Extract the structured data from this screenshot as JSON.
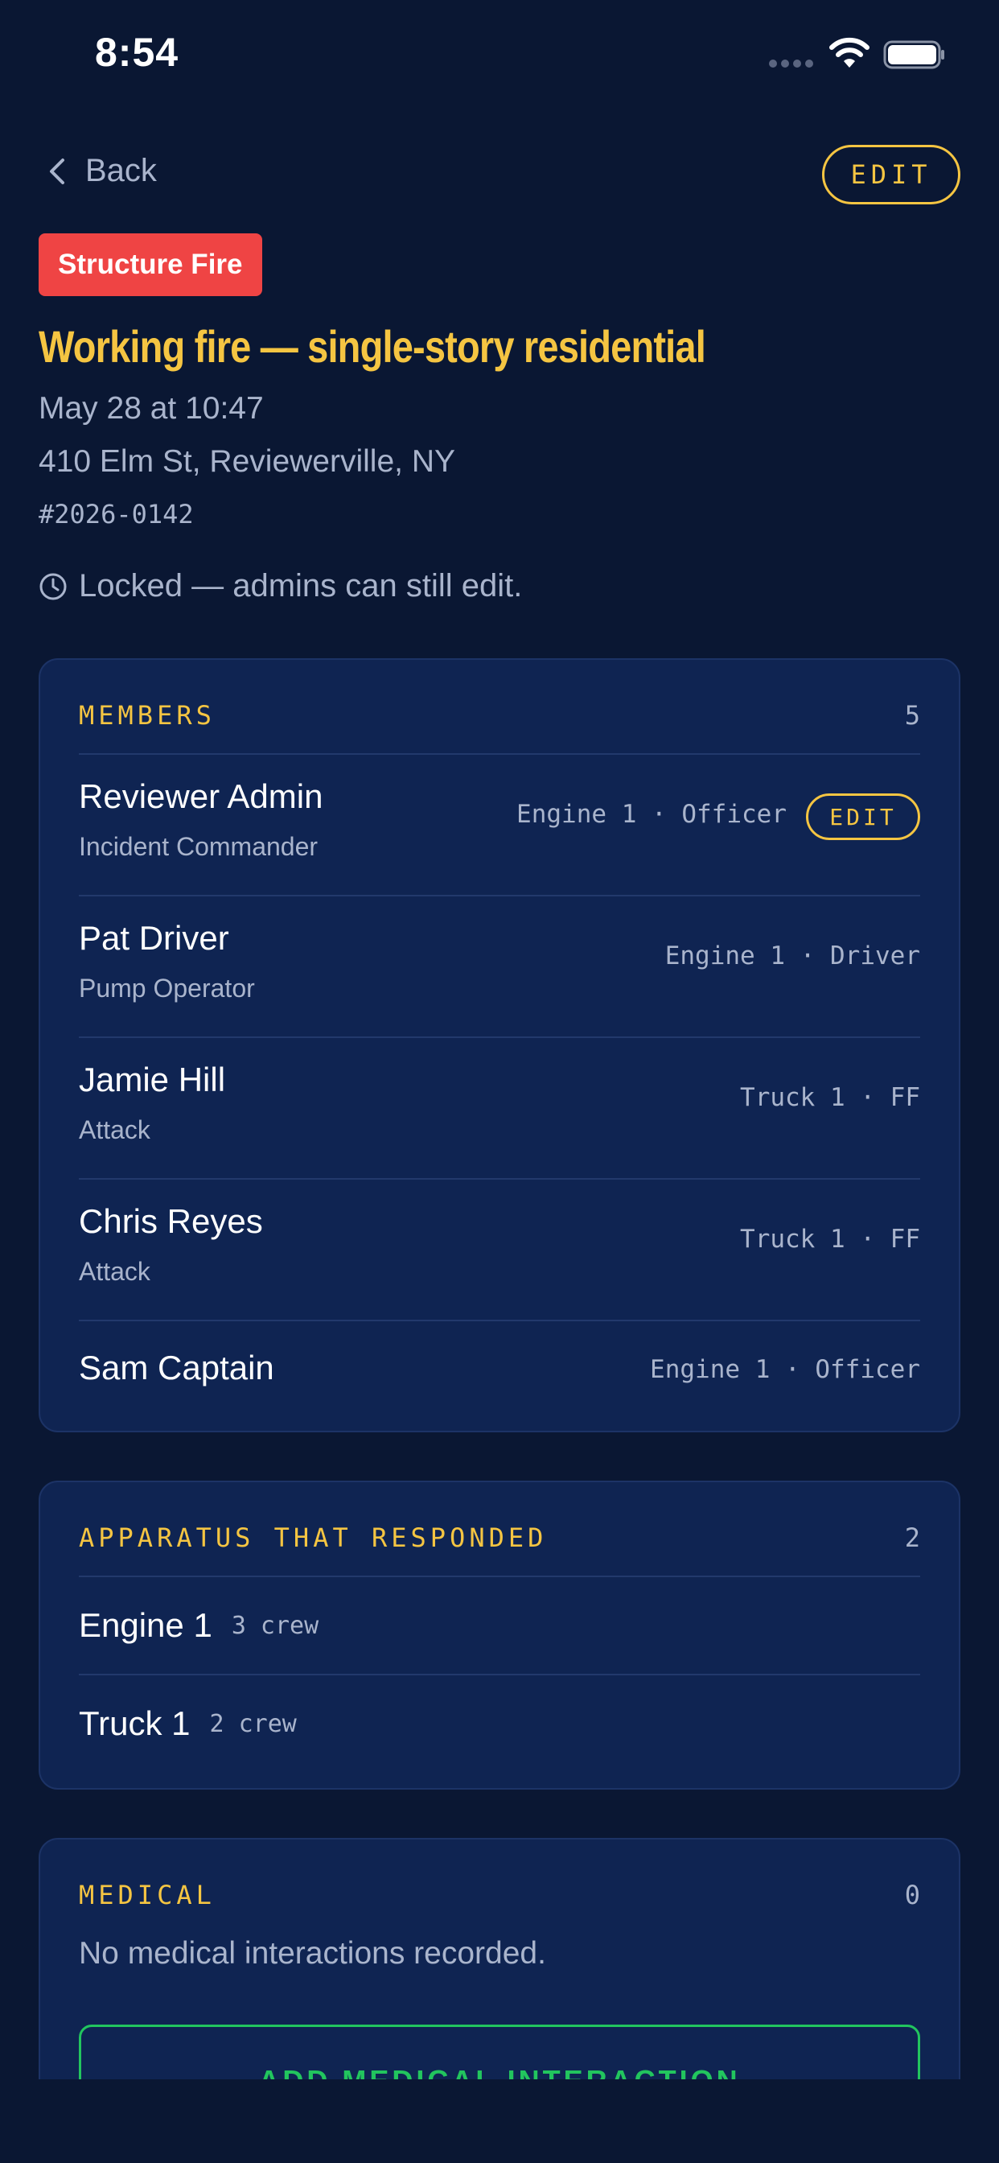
{
  "status_bar": {
    "time": "8:54"
  },
  "nav": {
    "back_label": "Back",
    "edit_label": "EDIT"
  },
  "incident": {
    "type_badge": "Structure Fire",
    "type_color": "#ef4444",
    "title": "Working fire — single-story residential",
    "date": "May 28 at 10:47",
    "address": "410 Elm St, Reviewerville, NY",
    "number": "#2026-0142",
    "lock_notice": "Locked — admins can still edit."
  },
  "members": {
    "label": "MEMBERS",
    "count": "5",
    "edit_label": "EDIT",
    "items": [
      {
        "name": "Reviewer Admin",
        "role": "Incident Commander",
        "unit": "Engine 1 · Officer"
      },
      {
        "name": "Pat Driver",
        "role": "Pump Operator",
        "unit": "Engine 1 · Driver"
      },
      {
        "name": "Jamie Hill",
        "role": "Attack",
        "unit": "Truck 1 · FF"
      },
      {
        "name": "Chris Reyes",
        "role": "Attack",
        "unit": "Truck 1 · FF"
      },
      {
        "name": "Sam Captain",
        "role": "",
        "unit": "Engine 1 · Officer"
      }
    ]
  },
  "apparatus": {
    "label": "APPARATUS THAT RESPONDED",
    "count": "2",
    "items": [
      {
        "name": "Engine 1",
        "crew": "3 crew"
      },
      {
        "name": "Truck 1",
        "crew": "2 crew"
      }
    ]
  },
  "medical": {
    "label": "MEDICAL",
    "count": "0",
    "empty_text": "No medical interactions recorded.",
    "add_button": "ADD MEDICAL INTERACTION"
  },
  "colors": {
    "background": "#0a1733",
    "card": "#0f2452",
    "accent": "#f5c542",
    "muted": "#a9b4cc",
    "success": "#22c55e"
  }
}
